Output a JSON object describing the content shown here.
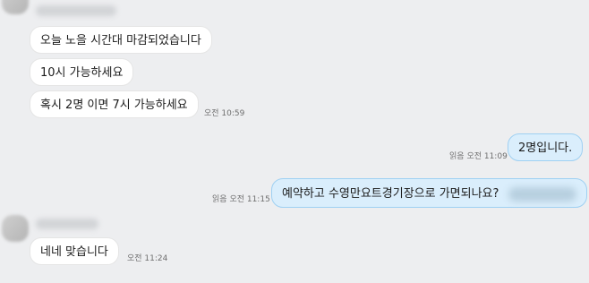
{
  "chat": {
    "messages": [
      {
        "text": "오늘 노을 시간대 마감되었습니다",
        "direction": "incoming"
      },
      {
        "text": "10시 가능하세요",
        "direction": "incoming"
      },
      {
        "text": "혹시 2명 이면 7시 가능하세요",
        "direction": "incoming",
        "time": "오전 10:59"
      },
      {
        "text": "2명입니다.",
        "direction": "outgoing",
        "read": "읽음",
        "time": "오전 11:09"
      },
      {
        "text": "예약하고 수영만요트경기장으로 가면되나요?",
        "direction": "outgoing",
        "read": "읽음",
        "time": "오전 11:15"
      },
      {
        "text": "네네 맞습니다",
        "direction": "incoming",
        "time": "오전 11:24"
      }
    ]
  },
  "colors": {
    "background": "#edeef0",
    "incoming_bubble": "#ffffff",
    "outgoing_bubble": "#daeefc",
    "outgoing_border": "#9fd0f2"
  }
}
